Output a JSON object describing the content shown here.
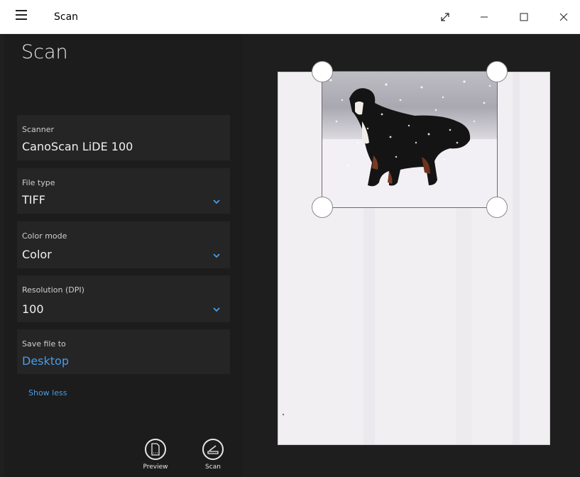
{
  "window": {
    "title": "Scan"
  },
  "panel": {
    "heading": "Scan",
    "scanner": {
      "label": "Scanner",
      "value": "CanoScan LiDE 100"
    },
    "file_type": {
      "label": "File type",
      "value": "TIFF"
    },
    "color_mode": {
      "label": "Color mode",
      "value": "Color"
    },
    "resolution": {
      "label": "Resolution (DPI)",
      "value": "100"
    },
    "save_to": {
      "label": "Save file to",
      "value": "Desktop"
    },
    "show_less": "Show less"
  },
  "actions": {
    "preview": "Preview",
    "scan": "Scan"
  },
  "icons": {
    "menu": "hamburger-icon",
    "fullscreen": "expand-icon",
    "minimize": "minimize-icon",
    "maximize": "maximize-icon",
    "close": "close-icon",
    "preview": "preview-icon",
    "scan": "scanner-icon",
    "dropdown": "chevron-down-icon"
  },
  "colors": {
    "accent": "#4a9be8",
    "panel_bg": "#1c1c1c",
    "card_bg": "#252525"
  }
}
